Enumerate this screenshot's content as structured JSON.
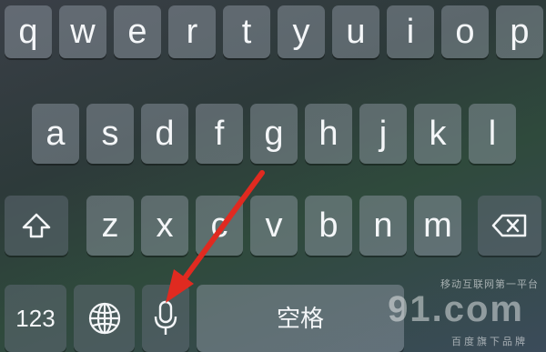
{
  "keyboard": {
    "row1": [
      "q",
      "w",
      "e",
      "r",
      "t",
      "y",
      "u",
      "i",
      "o",
      "p"
    ],
    "row2": [
      "a",
      "s",
      "d",
      "f",
      "g",
      "h",
      "j",
      "k",
      "l"
    ],
    "row3": [
      "z",
      "x",
      "c",
      "v",
      "b",
      "n",
      "m"
    ],
    "numbers_label": "123",
    "space_label": "空格",
    "icons": {
      "shift": "shift-icon",
      "delete": "delete-icon",
      "globe": "globe-icon",
      "microphone": "microphone-icon"
    }
  },
  "annotation": {
    "arrow_color": "#e02a20"
  },
  "watermark": {
    "line1": "移动互联网第一平台",
    "logo": "91.com",
    "line2": "百度旗下品牌"
  }
}
